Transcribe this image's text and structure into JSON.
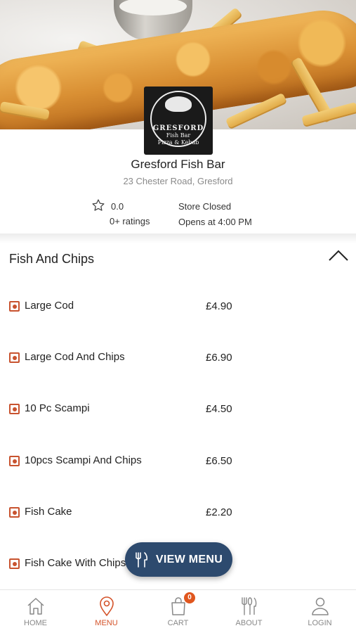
{
  "store": {
    "name": "Gresford Fish Bar",
    "address": "23 Chester Road, Gresford",
    "rating": "0.0",
    "rating_count": "0+ ratings",
    "status": "Store Closed",
    "opens": "Opens at 4:00 PM",
    "logo": {
      "line1": "GRESFORD",
      "line2": "Fish Bar",
      "line3": "Pizza & Kebab"
    }
  },
  "category": {
    "title": "Fish And Chips"
  },
  "items": [
    {
      "name": "Large Cod",
      "price": "£4.90"
    },
    {
      "name": "Large Cod And Chips",
      "price": "£6.90"
    },
    {
      "name": "10 Pc Scampi",
      "price": "£4.50"
    },
    {
      "name": "10pcs Scampi And Chips",
      "price": "£6.50"
    },
    {
      "name": "Fish Cake",
      "price": "£2.20"
    },
    {
      "name": "Fish Cake With Chips",
      "price": ""
    }
  ],
  "view_menu": {
    "label": "VIEW MENU",
    "icon": "cutlery-icon"
  },
  "tabbar": {
    "home": "HOME",
    "menu": "MENU",
    "cart": "CART",
    "cart_count": "0",
    "about": "ABOUT",
    "login": "LOGIN"
  },
  "colors": {
    "accent": "#d4532a",
    "button": "#2d4a6e",
    "veg_mark": "#c8532f"
  }
}
